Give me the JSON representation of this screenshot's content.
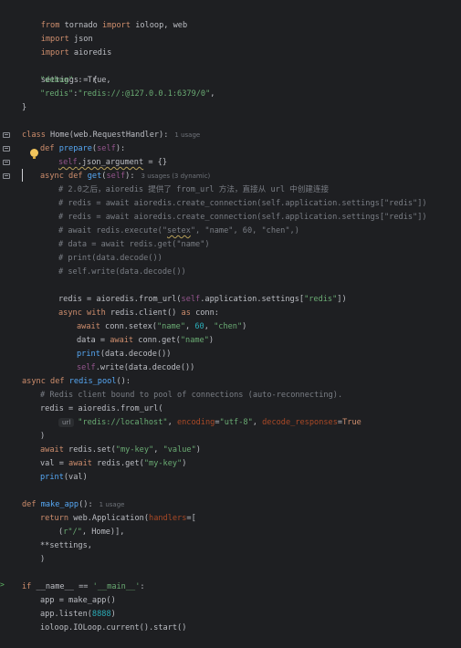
{
  "gutter": {
    "icons": [
      "method-override-icon",
      "method-override-icon",
      "method-override-icon",
      "method-override-icon"
    ],
    "run_icon": "run-arrow-icon"
  },
  "code": {
    "l1": "from tornado import ioloop, web",
    "l2": "import json",
    "l3": "import aioredis",
    "l5_settings": "settings = {",
    "l6_key": "\"debug\"",
    "l6_rest": " : True,",
    "l7_key": "\"redis\"",
    "l7_val": "\"redis://:@127.0.0.1:6379/0\"",
    "l8": "}",
    "l10_a": "class Home(web.RequestHandler):",
    "l10_usage": "1 usage",
    "l11_a": "def ",
    "l11_fn": "prepare",
    "l11_b": "(self):",
    "l12_a": "self",
    "l12_b": ".json_argument",
    "l12_c": " = {}",
    "l13_a": "async def ",
    "l13_fn": "get",
    "l13_b": "(self):",
    "l13_usage": "3 usages (3 dynamic)",
    "c1": "# 2.0之后，aioredis 提供了 from_url 方法，直接从 url 中创建连接",
    "c2": "# redis = await aioredis.create_connection(self.application.settings[\"redis\"])",
    "c3": "# redis = await aioredis.create_connection(self.application.settings[\"redis\"])",
    "c4_a": "# await redis.execute(\"",
    "c4_u": "setex",
    "c4_b": "\", \"name\", 60, \"chen\",)",
    "c5": "# data = await redis.get(\"name\")",
    "c6": "# print(data.decode())",
    "c7": "# self.write(data.decode())",
    "r1_a": "redis = aioredis.from_url(",
    "r1_self": "self",
    "r1_b": ".application.settings[",
    "r1_str": "\"redis\"",
    "r1_c": "])",
    "r2_a": "async with ",
    "r2_b": "redis.client() ",
    "r2_c": "as ",
    "r2_d": "conn:",
    "r3_a": "await ",
    "r3_b": "conn.setex(",
    "r3_s1": "\"name\"",
    "r3_n": "60",
    "r3_s2": "\"chen\"",
    "r4_a": "data = ",
    "r4_b": "await ",
    "r4_c": "conn.get(",
    "r4_s": "\"name\"",
    "r5": "print(data.decode())",
    "r6_self": "self",
    "r6_b": ".write(data.decode())",
    "p1_a": "async def ",
    "p1_fn": "redis_pool",
    "p1_b": "():",
    "p2": "# Redis client bound to pool of connections (auto-reconnecting).",
    "p3": "redis = aioredis.from_url(",
    "p4_hint": "url",
    "p4_url": "\"redis://localhost\"",
    "p4_enc_k": "encoding",
    "p4_enc_v": "\"utf-8\"",
    "p4_dec_k": "decode_responses",
    "p4_dec_v": "True",
    "p5": ")",
    "p6_a": "await ",
    "p6_b": "redis.set(",
    "p6_s1": "\"my-key\"",
    "p6_s2": "\"value\"",
    "p7_a": "val = ",
    "p7_b": "await ",
    "p7_c": "redis.get(",
    "p7_s": "\"my-key\"",
    "p8": "print(val)",
    "m1_a": "def ",
    "m1_fn": "make_app",
    "m1_b": "():",
    "m1_usage": "1 usage",
    "m2_a": "return ",
    "m2_b": "web.Application(",
    "m2_k": "handlers",
    "m2_c": "=[",
    "m3_s": "r\"/\"",
    "m3_b": ", Home)],",
    "m4": "**settings,",
    "m5": ")",
    "x1_a": "if ",
    "x1_b": "__name__ == ",
    "x1_s": "'__main__'",
    "x1_c": ":",
    "x2": "app = make_app()",
    "x3_a": "app.listen(",
    "x3_n": "8888",
    "x3_b": ")",
    "x4": "ioloop.IOLoop.current().start()"
  }
}
